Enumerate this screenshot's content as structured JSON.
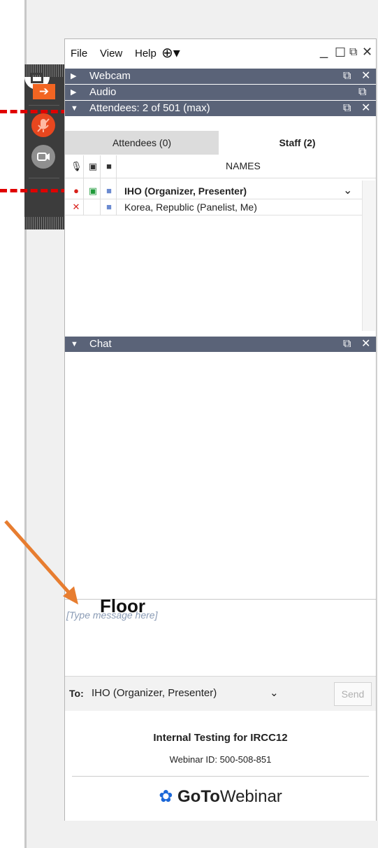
{
  "menu": {
    "file": "File",
    "view": "View",
    "help": "Help"
  },
  "sections": {
    "webcam": "Webcam",
    "audio": "Audio",
    "attendees": "Attendees:  2 of 501 (max)",
    "chat": "Chat"
  },
  "tabs": {
    "attendees": "Attendees (0)",
    "staff": "Staff (2)"
  },
  "table": {
    "names_header": "NAMES",
    "rows": [
      {
        "name": "IHO (Organizer, Presenter)"
      },
      {
        "name": "Korea, Republic (Panelist, Me)"
      }
    ]
  },
  "chat": {
    "placeholder": "[Type message here]"
  },
  "annotation": {
    "floor_label": "Floor"
  },
  "to_bar": {
    "to_label": "To:",
    "recipient": "IHO (Organizer, Presenter)",
    "send_label": "Send"
  },
  "footer": {
    "title": "Internal Testing for IRCC12",
    "webinar_id": "Webinar ID: 500-508-851",
    "brand_bold": "GoTo",
    "brand_light": "Webinar"
  },
  "colors": {
    "accent_orange": "#f26522",
    "header_bg": "#5a6378",
    "mic_red": "#e8471f",
    "highlight_red": "#e00000"
  }
}
